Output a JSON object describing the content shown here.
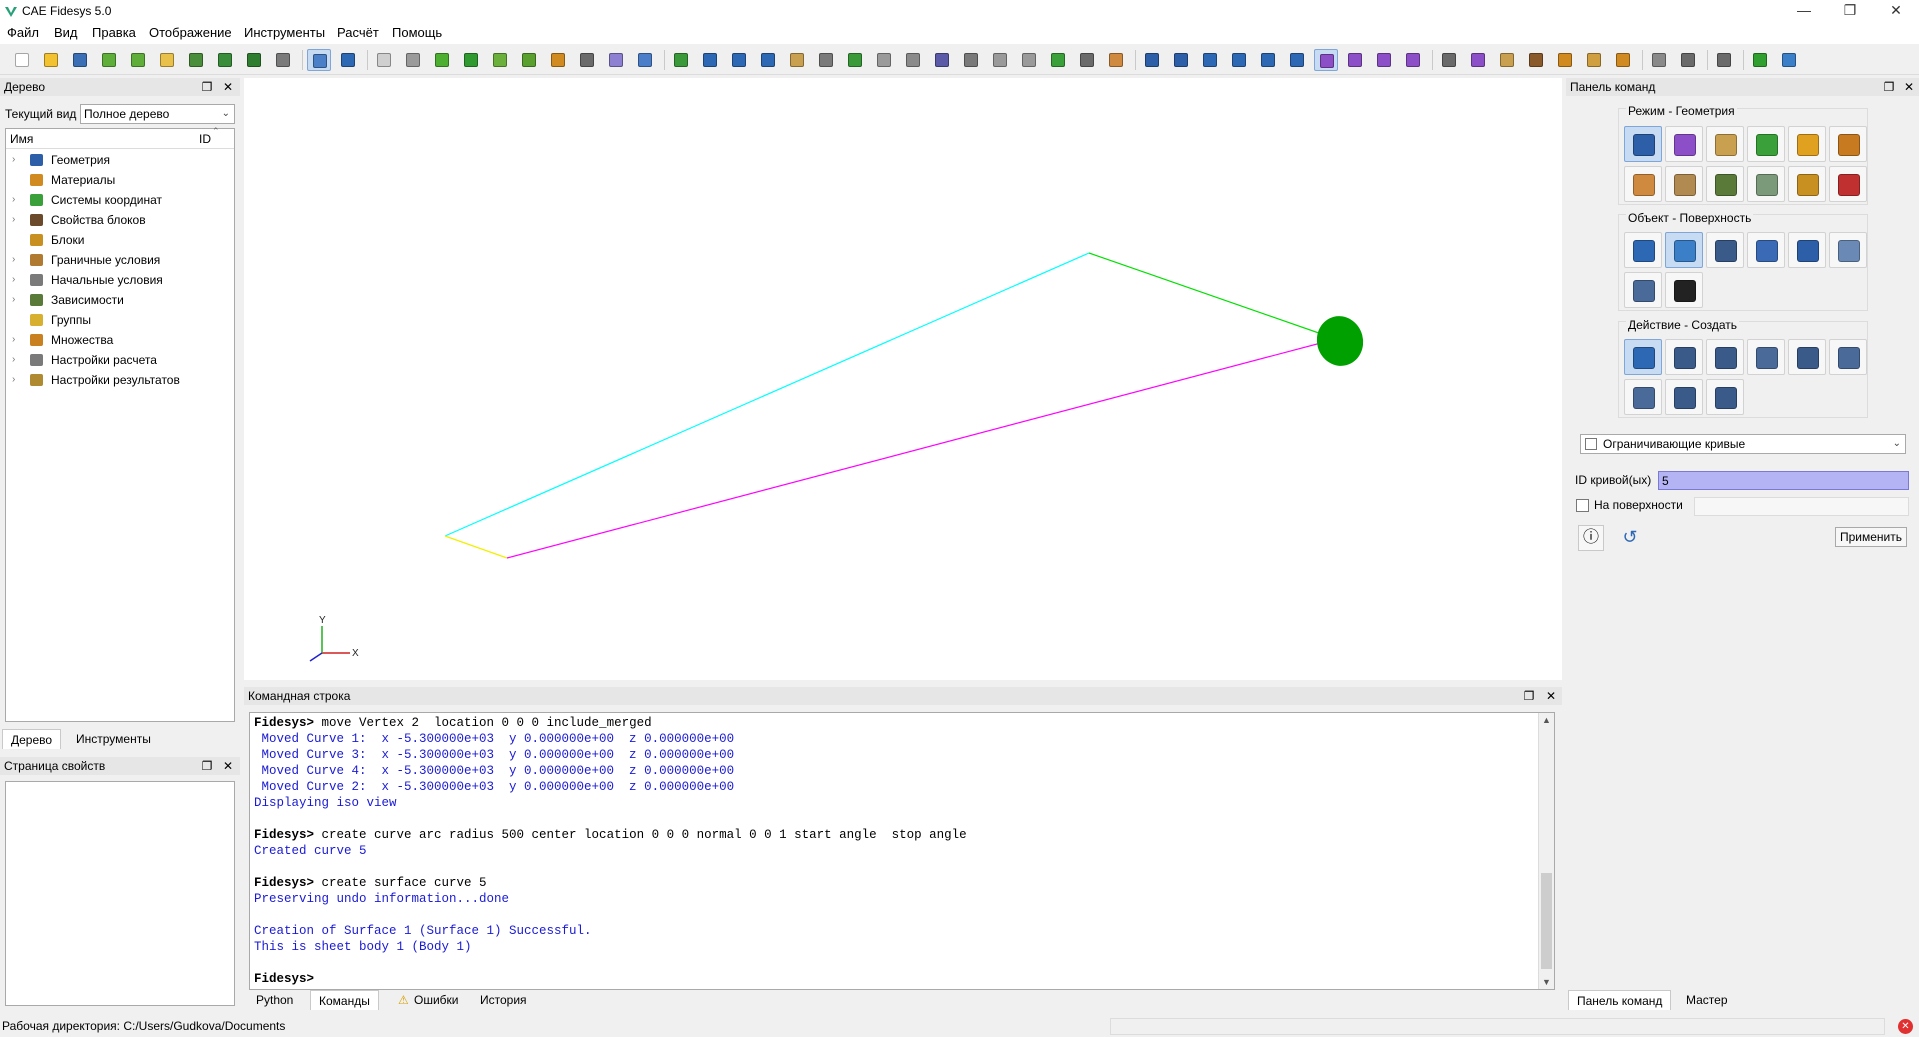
{
  "window": {
    "title": "CAE Fidesys 5.0",
    "controls": [
      "—",
      "❐",
      "✕"
    ]
  },
  "menu": [
    "Файл",
    "Вид",
    "Правка",
    "Отображение",
    "Инструменты",
    "Расчёт",
    "Помощь"
  ],
  "toolbar": {
    "buttons": [
      {
        "name": "new-file-icon",
        "color": "#ffffff"
      },
      {
        "name": "open-folder-icon",
        "color": "#f2c230"
      },
      {
        "name": "save-icon",
        "color": "#3a6fb5"
      },
      {
        "name": "import-icon",
        "color": "#5fae3a"
      },
      {
        "name": "export-icon",
        "color": "#5fae3a"
      },
      {
        "name": "journal-icon",
        "color": "#e8c04a"
      },
      {
        "name": "play-journal-icon",
        "color": "#4a8d3a"
      },
      {
        "name": "record-icon",
        "color": "#3a8d3a"
      },
      {
        "name": "stop-icon",
        "color": "#2f7d2f"
      },
      {
        "name": "tools-icon",
        "color": "#7a7a7a"
      },
      {
        "name": "select-icon",
        "color": "#4b7fc8"
      },
      {
        "name": "undo-icon",
        "color": "#2d68b5"
      },
      {
        "name": "wire-cube-icon",
        "color": "#cfcfcf"
      },
      {
        "name": "hidden-cube-icon",
        "color": "#9a9a9a"
      },
      {
        "name": "shaded-cube-icon",
        "color": "#4caf2f"
      },
      {
        "name": "solid-cube-icon",
        "color": "#2f9a2f"
      },
      {
        "name": "mesh-display-icon",
        "color": "#6bb03a"
      },
      {
        "name": "geometry-display-icon",
        "color": "#5aa02f"
      },
      {
        "name": "node-display-icon",
        "color": "#d08a20"
      },
      {
        "name": "grid-icon",
        "color": "#6a6a6a"
      },
      {
        "name": "box-icon",
        "color": "#8d7fd1"
      },
      {
        "name": "window-icon",
        "color": "#4a7ec8"
      },
      {
        "name": "refresh-icon",
        "color": "#3a9a3a"
      },
      {
        "name": "zoom-in-icon",
        "color": "#2d68b5"
      },
      {
        "name": "zoom-out-icon",
        "color": "#2d68b5"
      },
      {
        "name": "globe-icon",
        "color": "#2d68b5"
      },
      {
        "name": "section-icon",
        "color": "#c8a050"
      },
      {
        "name": "front-view-icon",
        "color": "#7a7a7a"
      },
      {
        "name": "back-view-icon",
        "color": "#3a9a3a"
      },
      {
        "name": "side-view-icon",
        "color": "#9a9a9a"
      },
      {
        "name": "iso-view-icon",
        "color": "#8a8a8a"
      },
      {
        "name": "view-circle-icon",
        "color": "#5a5aa8"
      },
      {
        "name": "fit-icon",
        "color": "#7a7a7a"
      },
      {
        "name": "scale-icon",
        "color": "#9a9a9a"
      },
      {
        "name": "crop-icon",
        "color": "#9a9a9a"
      },
      {
        "name": "axes-icon",
        "color": "#3aa03a"
      },
      {
        "name": "ibeam-icon",
        "color": "#6a6a6a"
      },
      {
        "name": "material-icon",
        "color": "#d08a40"
      },
      {
        "name": "volume-group-icon",
        "color": "#2d5fa8"
      },
      {
        "name": "volumes-icon",
        "color": "#2d5fa8"
      },
      {
        "name": "volume-icon",
        "color": "#2d68b5"
      },
      {
        "name": "surface-icon",
        "color": "#2d68b5"
      },
      {
        "name": "curve-icon",
        "color": "#2d68b5"
      },
      {
        "name": "vertex-icon",
        "color": "#2d68b5"
      },
      {
        "name": "node-icon",
        "color": "#8d4fc8"
      },
      {
        "name": "edge-icon",
        "color": "#8d4fc8"
      },
      {
        "name": "face-icon",
        "color": "#8d4fc8"
      },
      {
        "name": "hex-icon",
        "color": "#8d4fc8"
      },
      {
        "name": "grid-3d-icon",
        "color": "#6a6a6a"
      },
      {
        "name": "element-icon",
        "color": "#8d4fc8"
      },
      {
        "name": "constraint-icon",
        "color": "#c8a050"
      },
      {
        "name": "load-icon",
        "color": "#8a5a2a"
      },
      {
        "name": "force-icon",
        "color": "#d08a20"
      },
      {
        "name": "pressure-icon",
        "color": "#d0a040"
      },
      {
        "name": "temperature-icon",
        "color": "#d08a20"
      },
      {
        "name": "contact-icon",
        "color": "#8a8a8a"
      },
      {
        "name": "text-icon",
        "color": "#6a6a6a"
      },
      {
        "name": "fit-all-icon",
        "color": "#6a6a6a"
      },
      {
        "name": "run-icon",
        "color": "#2fa02f"
      },
      {
        "name": "results-icon",
        "color": "#3a7fc8"
      }
    ]
  },
  "tree_panel": {
    "title": "Дерево",
    "current_view_label": "Текущий вид",
    "current_view_value": "Полное дерево",
    "col_name": "Имя",
    "col_id": "ID",
    "items": [
      {
        "label": "Геометрия",
        "icon": "geometry-icon",
        "color": "#2d5fa8",
        "has_children": true
      },
      {
        "label": "Материалы",
        "icon": "materials-icon",
        "color": "#d08a20",
        "has_children": false
      },
      {
        "label": "Системы координат",
        "icon": "coordinate-systems-icon",
        "color": "#3aa03a",
        "has_children": true
      },
      {
        "label": "Свойства блоков",
        "icon": "block-properties-icon",
        "color": "#6a4a2a",
        "has_children": true
      },
      {
        "label": "Блоки",
        "icon": "blocks-icon",
        "color": "#c89020",
        "has_children": false
      },
      {
        "label": "Граничные условия",
        "icon": "boundary-conditions-icon",
        "color": "#b07a30",
        "has_children": true
      },
      {
        "label": "Начальные условия",
        "icon": "initial-conditions-icon",
        "color": "#7a7a7a",
        "has_children": true
      },
      {
        "label": "Зависимости",
        "icon": "dependencies-icon",
        "color": "#5a7a3a",
        "has_children": true
      },
      {
        "label": "Группы",
        "icon": "groups-icon",
        "color": "#d8b030",
        "has_children": false
      },
      {
        "label": "Множества",
        "icon": "sets-icon",
        "color": "#c88020",
        "has_children": true
      },
      {
        "label": "Настройки расчета",
        "icon": "calc-settings-icon",
        "color": "#7a7a7a",
        "has_children": true
      },
      {
        "label": "Настройки результатов",
        "icon": "result-settings-icon",
        "color": "#b08a30",
        "has_children": true
      }
    ],
    "tabs": [
      "Дерево",
      "Инструменты"
    ]
  },
  "properties_panel": {
    "title": "Страница свойств"
  },
  "command_line": {
    "title": "Командная строка",
    "lines": [
      {
        "type": "in",
        "prompt": "Fidesys>",
        "text": " move Vertex 2  location 0 0 0 include_merged"
      },
      {
        "type": "out",
        "prompt": "",
        "text": " Moved Curve 1:  x -5.300000e+03  y 0.000000e+00  z 0.000000e+00"
      },
      {
        "type": "out",
        "prompt": "",
        "text": " Moved Curve 3:  x -5.300000e+03  y 0.000000e+00  z 0.000000e+00"
      },
      {
        "type": "out",
        "prompt": "",
        "text": " Moved Curve 4:  x -5.300000e+03  y 0.000000e+00  z 0.000000e+00"
      },
      {
        "type": "out",
        "prompt": "",
        "text": " Moved Curve 2:  x -5.300000e+03  y 0.000000e+00  z 0.000000e+00"
      },
      {
        "type": "out",
        "prompt": "",
        "text": "Displaying iso view"
      },
      {
        "type": "blank",
        "prompt": "",
        "text": " "
      },
      {
        "type": "in",
        "prompt": "Fidesys>",
        "text": " create curve arc radius 500 center location 0 0 0 normal 0 0 1 start angle  stop angle"
      },
      {
        "type": "out",
        "prompt": "",
        "text": "Created curve 5"
      },
      {
        "type": "blank",
        "prompt": "",
        "text": " "
      },
      {
        "type": "in",
        "prompt": "Fidesys>",
        "text": " create surface curve 5"
      },
      {
        "type": "out",
        "prompt": "",
        "text": "Preserving undo information...done"
      },
      {
        "type": "blank",
        "prompt": "",
        "text": " "
      },
      {
        "type": "out",
        "prompt": "",
        "text": "Creation of Surface 1 (Surface 1) Successful."
      },
      {
        "type": "out",
        "prompt": "",
        "text": "This is sheet body 1 (Body 1)"
      },
      {
        "type": "blank",
        "prompt": "",
        "text": " "
      },
      {
        "type": "in",
        "prompt": "Fidesys>",
        "text": ""
      }
    ],
    "tabs": [
      "Python",
      "Команды",
      "Ошибки",
      "История"
    ]
  },
  "command_panel": {
    "title": "Панель команд",
    "mode_group": "Режим - Геометрия",
    "mode_buttons": [
      {
        "name": "geometry-mode-icon",
        "color": "#2d5fa8"
      },
      {
        "name": "mesh-mode-icon",
        "color": "#8d4fc8"
      },
      {
        "name": "material-mode-icon",
        "color": "#c8a050"
      },
      {
        "name": "coord-mode-icon",
        "color": "#3aa03a"
      },
      {
        "name": "block-mode-icon",
        "color": "#e0a020"
      },
      {
        "name": "set-mode-icon",
        "color": "#c87a20"
      },
      {
        "name": "bc-mode-icon",
        "color": "#d08a40"
      },
      {
        "name": "initial-mode-icon",
        "color": "#b08a50"
      },
      {
        "name": "dependency-mode-icon",
        "color": "#5a7a3a"
      },
      {
        "name": "settings-mode-icon",
        "color": "#7a9a7a"
      },
      {
        "name": "results-mode-icon",
        "color": "#c89020"
      },
      {
        "name": "analysis-mode-icon",
        "color": "#c03030"
      }
    ],
    "object_group": "Объект - Поверхность",
    "object_buttons": [
      {
        "name": "volume-object-icon",
        "color": "#2d68b5"
      },
      {
        "name": "surface-object-icon",
        "color": "#3a7fc8"
      },
      {
        "name": "curve-object-icon",
        "color": "#3a5a8a"
      },
      {
        "name": "vertex-object-icon",
        "color": "#3a6ab5"
      },
      {
        "name": "body-object-icon",
        "color": "#2d5fa8"
      },
      {
        "name": "group-object-icon",
        "color": "#6a8ab5"
      },
      {
        "name": "measure-object-icon",
        "color": "#4a6a9a"
      },
      {
        "name": "text-object-icon",
        "color": "#222222"
      }
    ],
    "action_group": "Действие - Создать",
    "action_buttons": [
      {
        "name": "create-action-icon",
        "color": "#2d68b5"
      },
      {
        "name": "modify-action-icon",
        "color": "#3a5a8a"
      },
      {
        "name": "transform-action-icon",
        "color": "#3a5a8a"
      },
      {
        "name": "copy-action-icon",
        "color": "#4a6a9a"
      },
      {
        "name": "delete-action-icon",
        "color": "#3a5a8a"
      },
      {
        "name": "boolean-action-icon",
        "color": "#4a6a9a"
      },
      {
        "name": "merge-action-icon",
        "color": "#4a6a9a"
      },
      {
        "name": "cut-action-icon",
        "color": "#3a5a8a"
      },
      {
        "name": "pivot-action-icon",
        "color": "#3a5a8a"
      }
    ],
    "method_select": "Ограничивающие кривые",
    "curve_id_label": "ID кривой(ых)",
    "curve_id_value": "5",
    "on_surface_label": "На поверхности",
    "on_surface_value": "",
    "apply_label": "Применить",
    "tabs": [
      "Панель команд",
      "Мастер"
    ]
  },
  "statusbar": {
    "working_dir": "Рабочая директория: C:/Users/Gudkova/Documents"
  },
  "viewport": {
    "axes": {
      "x": "X",
      "y": "Y"
    },
    "colors": {
      "cyan": "#00ffff",
      "green": "#00e000",
      "magenta": "#ff00ff",
      "yellow": "#f0f000",
      "disk": "#00a000"
    }
  }
}
